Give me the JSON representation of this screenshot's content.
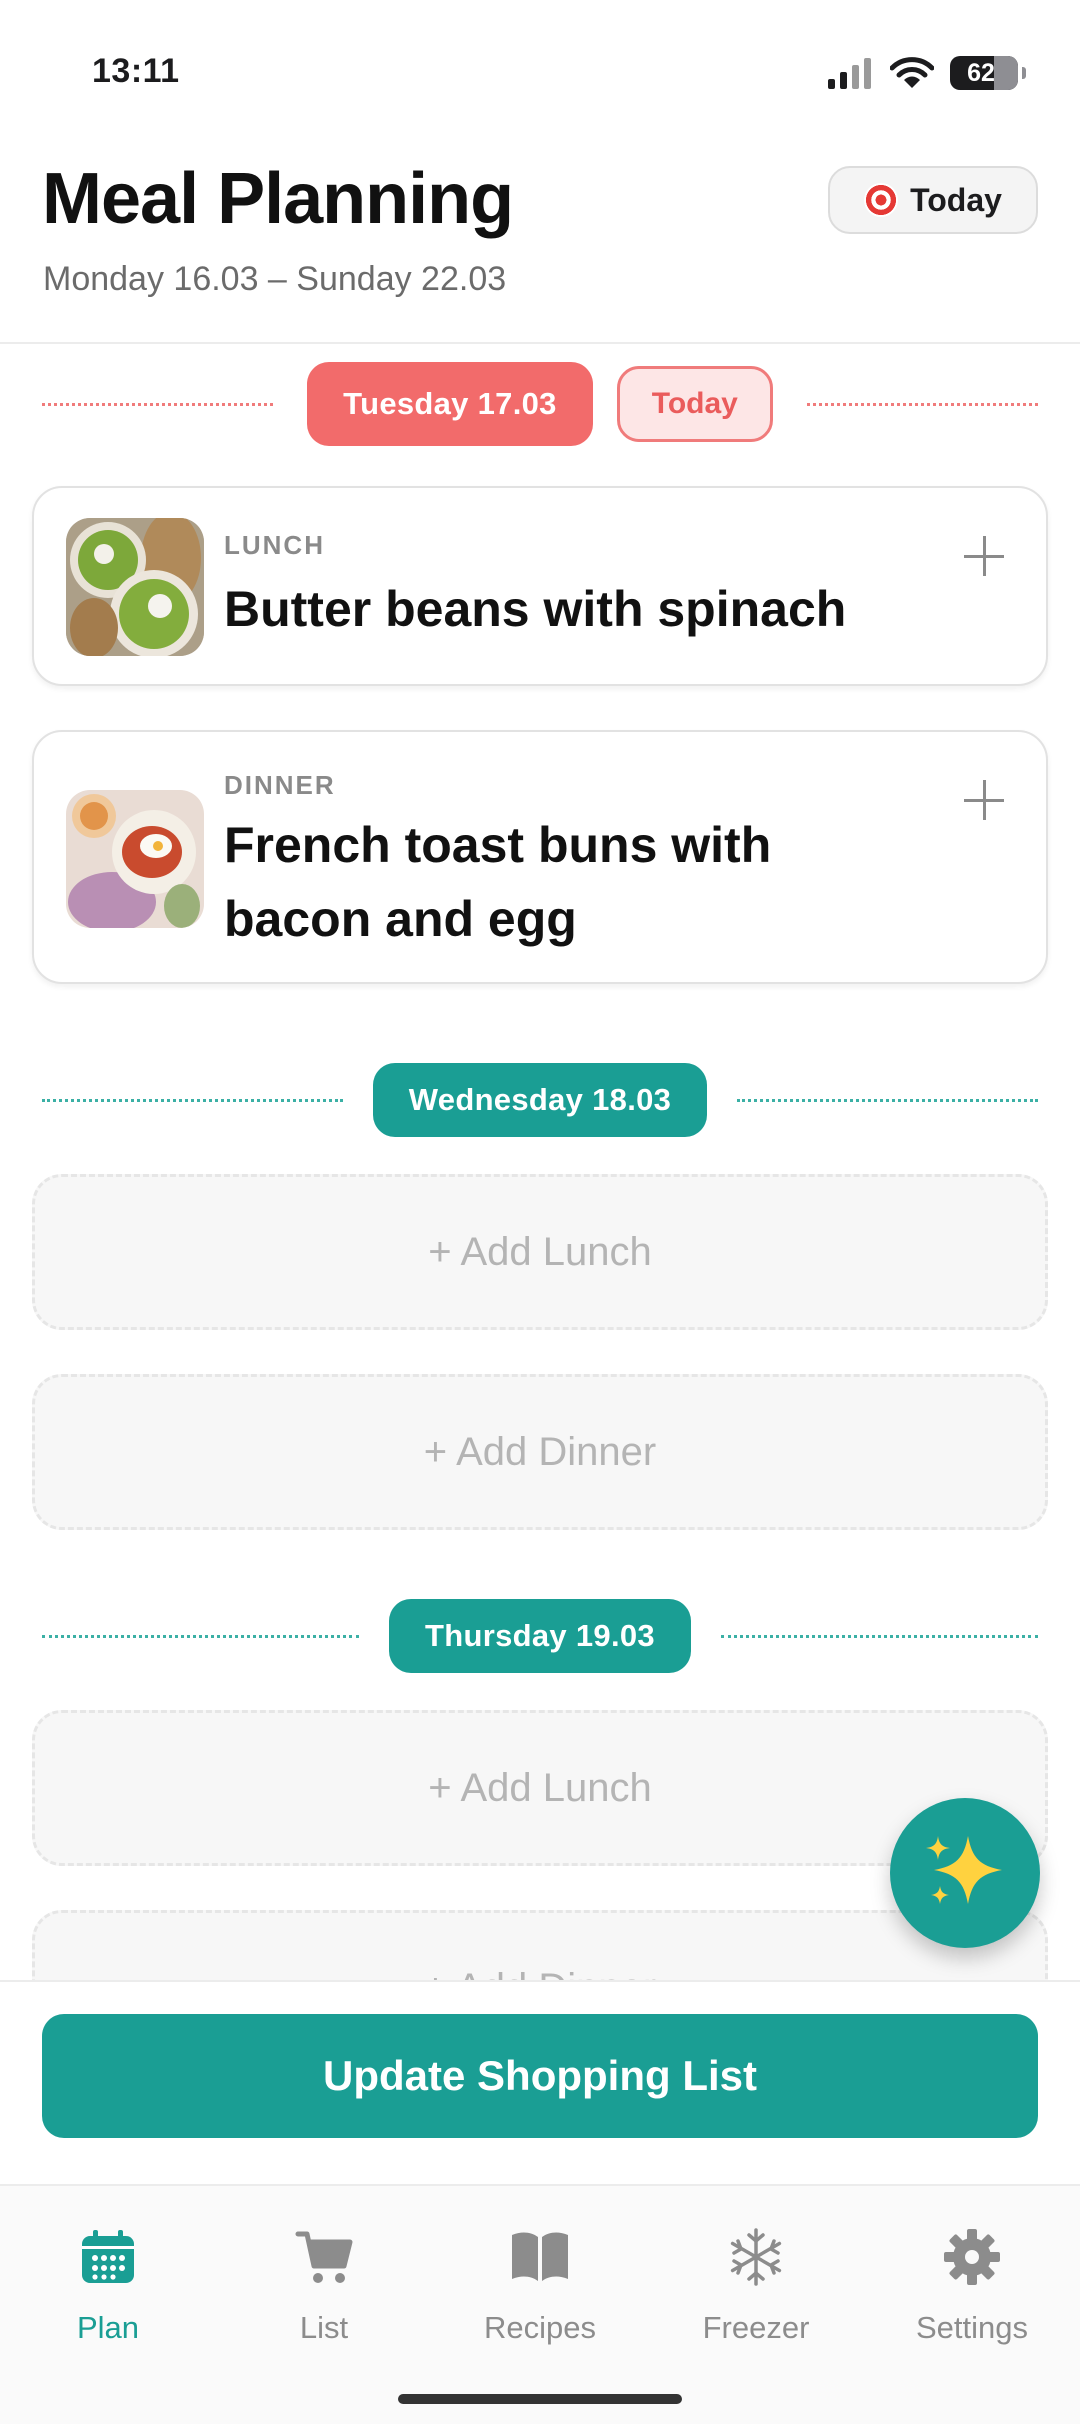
{
  "status": {
    "time": "13:11",
    "battery": "62"
  },
  "header": {
    "title": "Meal Planning",
    "week_range": "Monday 16.03 – Sunday 22.03",
    "today_button": "Today"
  },
  "days": [
    {
      "label": "Tuesday 17.03",
      "today_tag": "Today",
      "meals": [
        {
          "type": "LUNCH",
          "name": "Butter beans with spinach"
        },
        {
          "type": "DINNER",
          "name": "French toast buns with bacon and egg"
        }
      ]
    },
    {
      "label": "Wednesday 18.03",
      "slots": [
        "+ Add Lunch",
        "+ Add Dinner"
      ]
    },
    {
      "label": "Thursday 19.03",
      "slots": [
        "+ Add Lunch",
        "+ Add Dinner"
      ]
    }
  ],
  "fab_icon": "sparkles-icon",
  "action": {
    "update_button": "Update Shopping List"
  },
  "tabs": [
    {
      "label": "Plan",
      "icon": "calendar-icon",
      "active": true
    },
    {
      "label": "List",
      "icon": "cart-icon",
      "active": false
    },
    {
      "label": "Recipes",
      "icon": "book-icon",
      "active": false
    },
    {
      "label": "Freezer",
      "icon": "snowflake-icon",
      "active": false
    },
    {
      "label": "Settings",
      "icon": "gear-icon",
      "active": false
    }
  ],
  "colors": {
    "accent": "#1a9e94",
    "today": "#f26b6b"
  }
}
